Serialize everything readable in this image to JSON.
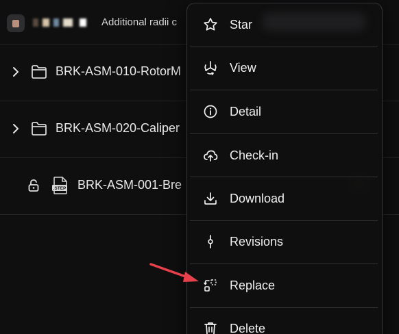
{
  "comment_row": {
    "comment_text": "Additional radii c"
  },
  "tree": {
    "folders": [
      {
        "name": "BRK-ASM-010-RotorM"
      },
      {
        "name": "BRK-ASM-020-Caliper"
      }
    ],
    "file": {
      "name": "BRK-ASM-001-Bre",
      "badge": ".STEP"
    }
  },
  "menu": {
    "items": [
      {
        "label": "Star",
        "icon": "star-icon"
      },
      {
        "label": "View",
        "icon": "view-3d-icon"
      },
      {
        "label": "Detail",
        "icon": "info-icon"
      },
      {
        "label": "Check-in",
        "icon": "cloud-upload-icon"
      },
      {
        "label": "Download",
        "icon": "download-icon"
      },
      {
        "label": "Revisions",
        "icon": "revisions-icon"
      },
      {
        "label": "Replace",
        "icon": "replace-icon"
      },
      {
        "label": "Delete",
        "icon": "trash-icon"
      }
    ]
  },
  "colors": {
    "background": "#0f0f10",
    "menu_bg": "#101011",
    "separator": "#262626",
    "annotation_arrow": "#e8404a"
  }
}
